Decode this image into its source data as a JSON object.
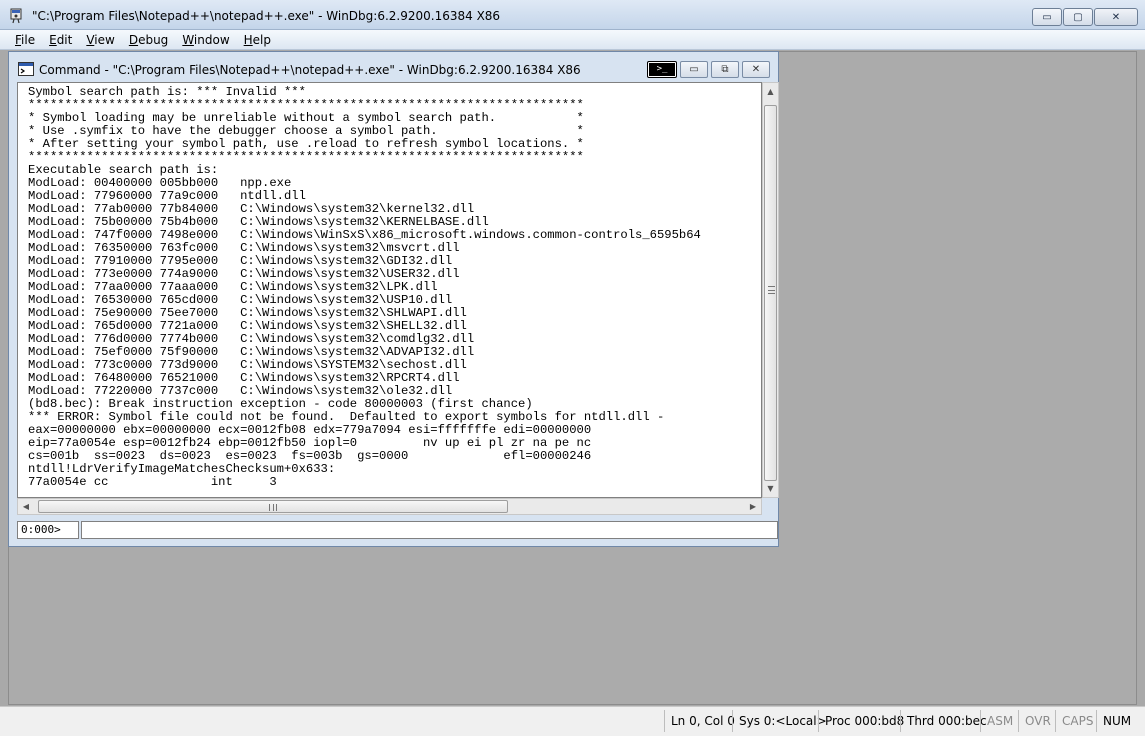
{
  "window": {
    "title": "\"C:\\Program Files\\Notepad++\\notepad++.exe\" - WinDbg:6.2.9200.16384 X86",
    "minimize_glyph": "▭",
    "maximize_glyph": "▢",
    "close_glyph": "✕"
  },
  "menu": {
    "file": {
      "accel": "F",
      "rest": "ile"
    },
    "edit": {
      "accel": "E",
      "rest": "dit"
    },
    "view": {
      "accel": "V",
      "rest": "iew"
    },
    "debug": {
      "accel": "D",
      "rest": "ebug"
    },
    "window": {
      "accel": "W",
      "rest": "indow"
    },
    "help": {
      "accel": "H",
      "rest": "elp"
    }
  },
  "command_window": {
    "title": "Command - \"C:\\Program Files\\Notepad++\\notepad++.exe\" - WinDbg:6.2.9200.16384 X86",
    "prompt_icon": ">_",
    "minimize_glyph": "▭",
    "restore_glyph": "⧉",
    "close_glyph": "✕",
    "output": "Symbol search path is: *** Invalid ***\n****************************************************************************\n* Symbol loading may be unreliable without a symbol search path.           *\n* Use .symfix to have the debugger choose a symbol path.                   *\n* After setting your symbol path, use .reload to refresh symbol locations. *\n****************************************************************************\nExecutable search path is:\nModLoad: 00400000 005bb000   npp.exe\nModLoad: 77960000 77a9c000   ntdll.dll\nModLoad: 77ab0000 77b84000   C:\\Windows\\system32\\kernel32.dll\nModLoad: 75b00000 75b4b000   C:\\Windows\\system32\\KERNELBASE.dll\nModLoad: 747f0000 7498e000   C:\\Windows\\WinSxS\\x86_microsoft.windows.common-controls_6595b64\nModLoad: 76350000 763fc000   C:\\Windows\\system32\\msvcrt.dll\nModLoad: 77910000 7795e000   C:\\Windows\\system32\\GDI32.dll\nModLoad: 773e0000 774a9000   C:\\Windows\\system32\\USER32.dll\nModLoad: 77aa0000 77aaa000   C:\\Windows\\system32\\LPK.dll\nModLoad: 76530000 765cd000   C:\\Windows\\system32\\USP10.dll\nModLoad: 75e90000 75ee7000   C:\\Windows\\system32\\SHLWAPI.dll\nModLoad: 765d0000 7721a000   C:\\Windows\\system32\\SHELL32.dll\nModLoad: 776d0000 7774b000   C:\\Windows\\system32\\comdlg32.dll\nModLoad: 75ef0000 75f90000   C:\\Windows\\system32\\ADVAPI32.dll\nModLoad: 773c0000 773d9000   C:\\Windows\\SYSTEM32\\sechost.dll\nModLoad: 76480000 76521000   C:\\Windows\\system32\\RPCRT4.dll\nModLoad: 77220000 7737c000   C:\\Windows\\system32\\ole32.dll\n(bd8.bec): Break instruction exception - code 80000003 (first chance)\n*** ERROR: Symbol file could not be found.  Defaulted to export symbols for ntdll.dll -\neax=00000000 ebx=00000000 ecx=0012fb08 edx=779a7094 esi=fffffffe edi=00000000\neip=77a0054e esp=0012fb24 ebp=0012fb50 iopl=0         nv up ei pl zr na pe nc\ncs=001b  ss=0023  ds=0023  es=0023  fs=003b  gs=0000             efl=00000246\nntdll!LdrVerifyImageMatchesChecksum+0x633:\n77a0054e cc              int     3",
    "prompt": "0:000>",
    "input_value": "",
    "vscroll_up": "▲",
    "vscroll_down": "▼",
    "hscroll_left": "◀",
    "hscroll_right": "▶"
  },
  "statusbar": {
    "position": "Ln 0, Col 0",
    "sys": "Sys 0:<Local>",
    "proc": "Proc 000:bd8",
    "thrd": "Thrd 000:bec",
    "asm": "ASM",
    "ovr": "OVR",
    "caps": "CAPS",
    "num": "NUM"
  }
}
